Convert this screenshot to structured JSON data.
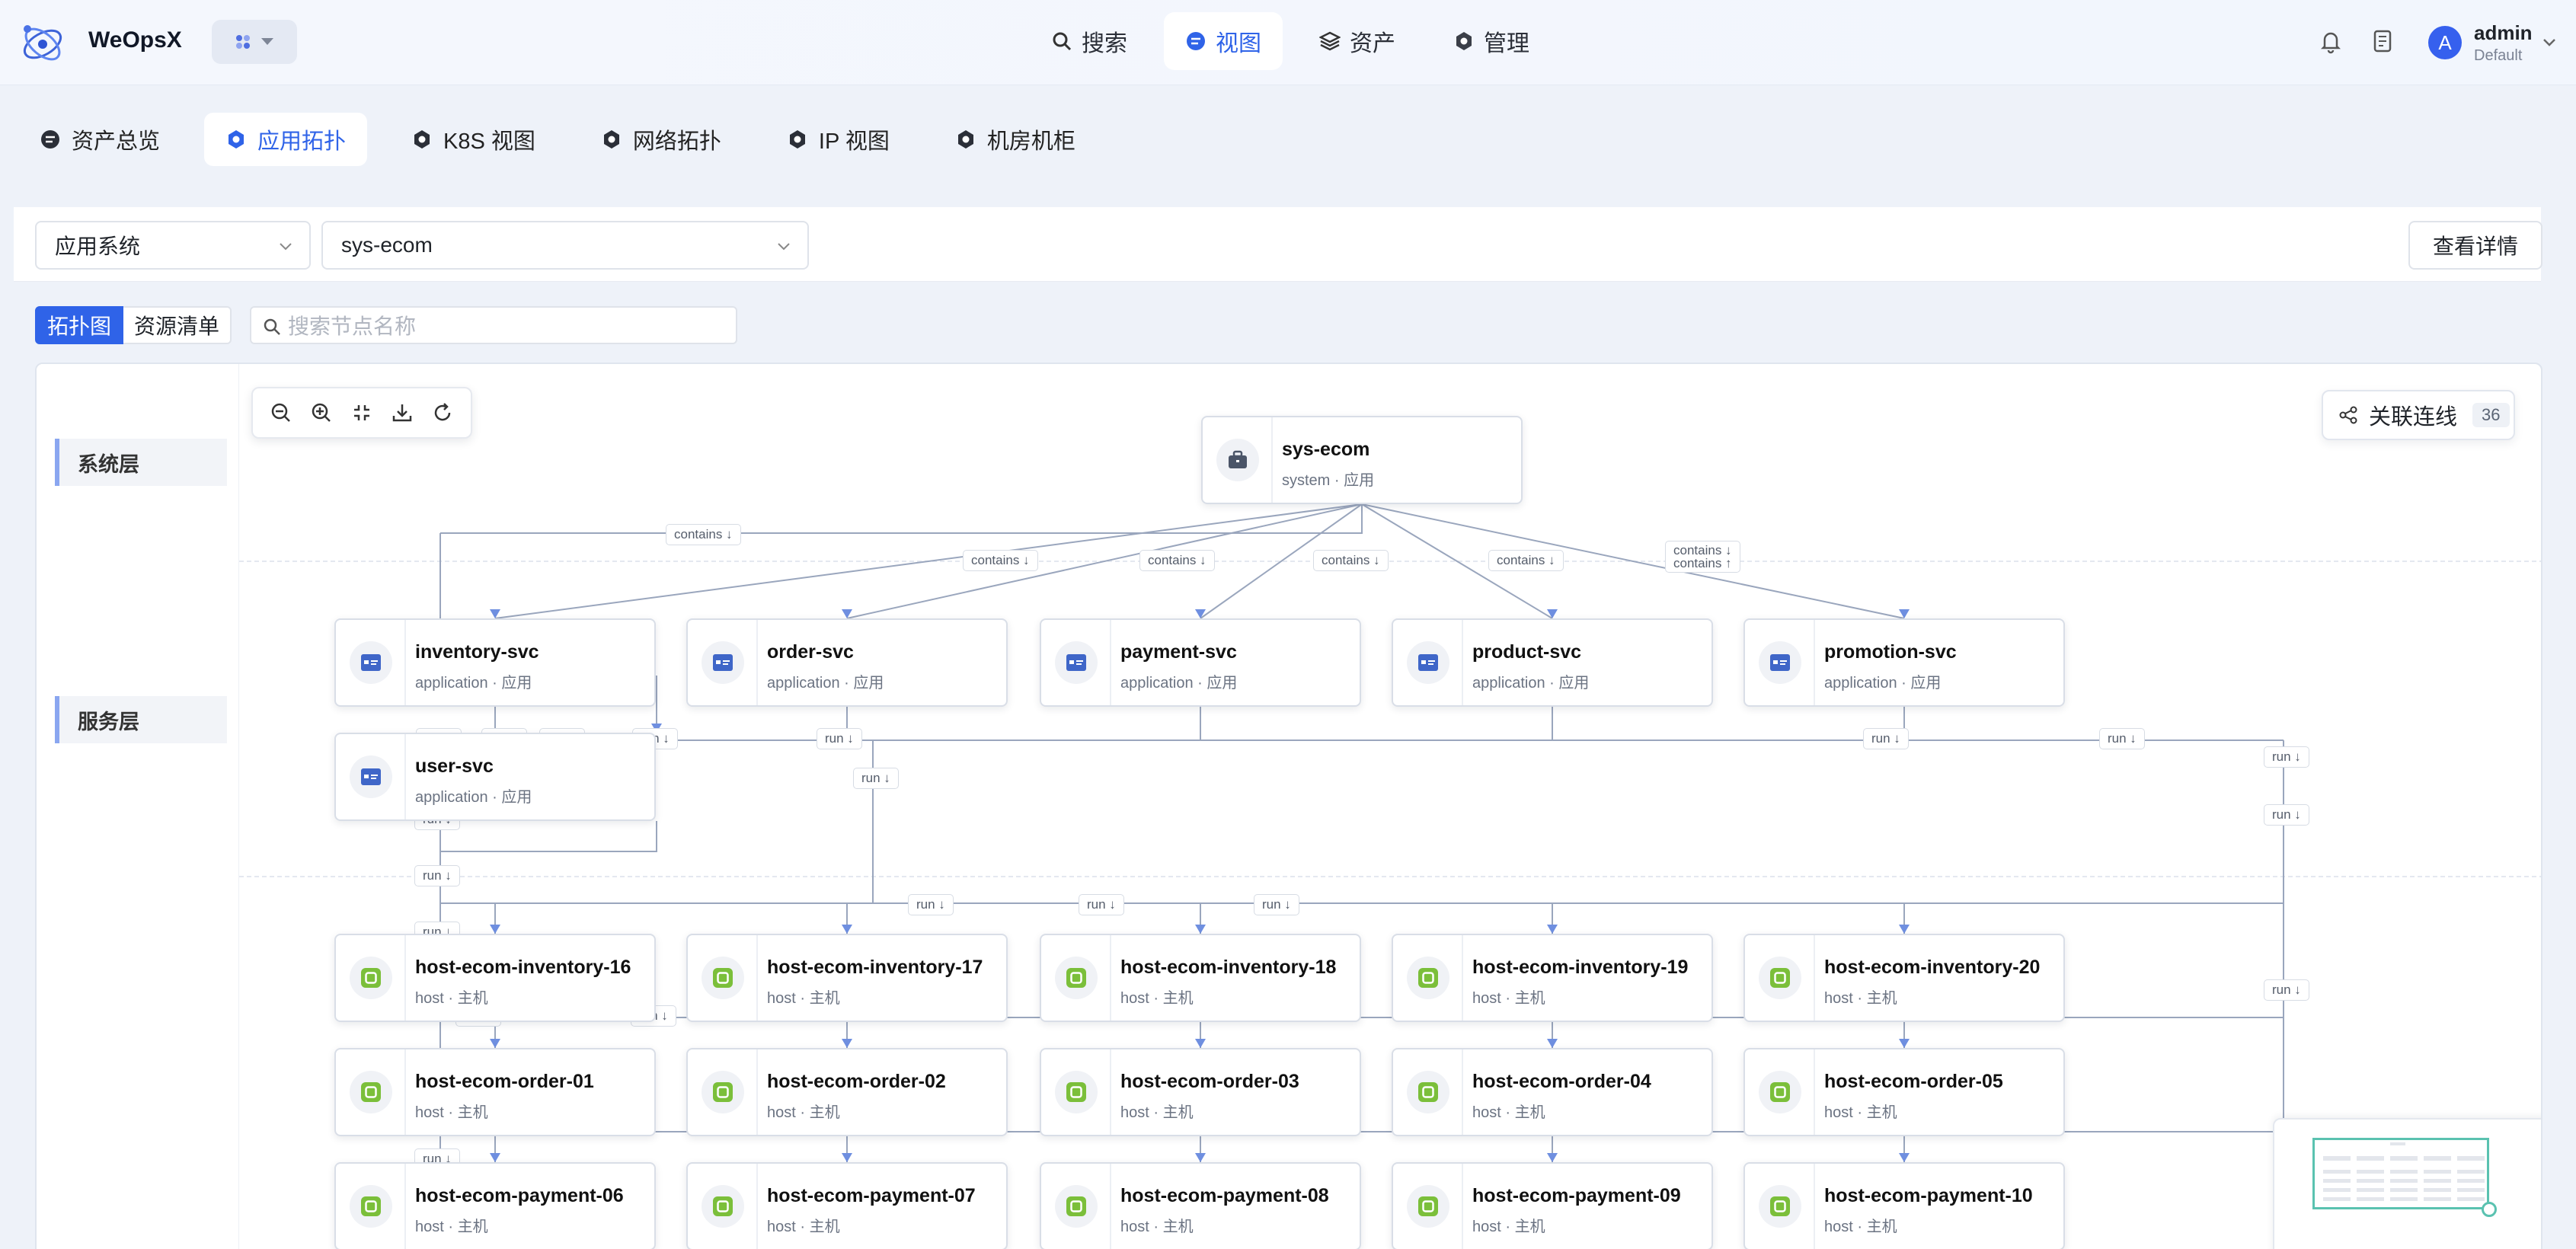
{
  "header": {
    "brand": "WeOpsX",
    "nav": [
      {
        "label": "搜索",
        "icon": "search-icon"
      },
      {
        "label": "视图",
        "icon": "view-icon",
        "active": true
      },
      {
        "label": "资产",
        "icon": "layers-icon"
      },
      {
        "label": "管理",
        "icon": "gear-icon"
      }
    ],
    "user": {
      "initial": "A",
      "name": "admin",
      "tenant": "Default"
    }
  },
  "subnav": [
    {
      "label": "资产总览"
    },
    {
      "label": "应用拓扑",
      "active": true
    },
    {
      "label": "K8S 视图"
    },
    {
      "label": "网络拓扑"
    },
    {
      "label": "IP 视图"
    },
    {
      "label": "机房机柜"
    }
  ],
  "filters": {
    "type_select": "应用系统",
    "system_select": "sys-ecom",
    "detail_button": "查看详情"
  },
  "view_toggle": {
    "topology": "拓扑图",
    "resources": "资源清单"
  },
  "search": {
    "placeholder": "搜索节点名称"
  },
  "layers": {
    "system": "系统层",
    "service": "服务层"
  },
  "links_button": {
    "label": "关联连线",
    "count": "36"
  },
  "colors": {
    "accent": "#2f63e8",
    "app_icon": "#3f66c8",
    "host_icon": "#7bbf3a",
    "edge": "#9aa6bd",
    "edge_arrow": "#6f8fe0",
    "minimap": "#5ac2b0"
  },
  "system_node": {
    "name": "sys-ecom",
    "sub": "system · 应用",
    "icon": "briefcase-icon"
  },
  "service_nodes": [
    {
      "name": "inventory-svc",
      "sub": "application · 应用"
    },
    {
      "name": "order-svc",
      "sub": "application · 应用"
    },
    {
      "name": "payment-svc",
      "sub": "application · 应用"
    },
    {
      "name": "product-svc",
      "sub": "application · 应用"
    },
    {
      "name": "promotion-svc",
      "sub": "application · 应用"
    },
    {
      "name": "user-svc",
      "sub": "application · 应用"
    }
  ],
  "host_nodes": [
    {
      "name": "host-ecom-inventory-16",
      "sub": "host · 主机"
    },
    {
      "name": "host-ecom-inventory-17",
      "sub": "host · 主机"
    },
    {
      "name": "host-ecom-inventory-18",
      "sub": "host · 主机"
    },
    {
      "name": "host-ecom-inventory-19",
      "sub": "host · 主机"
    },
    {
      "name": "host-ecom-inventory-20",
      "sub": "host · 主机"
    },
    {
      "name": "host-ecom-order-01",
      "sub": "host · 主机"
    },
    {
      "name": "host-ecom-order-02",
      "sub": "host · 主机"
    },
    {
      "name": "host-ecom-order-03",
      "sub": "host · 主机"
    },
    {
      "name": "host-ecom-order-04",
      "sub": "host · 主机"
    },
    {
      "name": "host-ecom-order-05",
      "sub": "host · 主机"
    },
    {
      "name": "host-ecom-payment-06",
      "sub": "host · 主机"
    },
    {
      "name": "host-ecom-payment-07",
      "sub": "host · 主机"
    },
    {
      "name": "host-ecom-payment-08",
      "sub": "host · 主机"
    },
    {
      "name": "host-ecom-payment-09",
      "sub": "host · 主机"
    },
    {
      "name": "host-ecom-payment-10",
      "sub": "host · 主机"
    }
  ],
  "edge_labels": {
    "contains": "contains ↓",
    "contains_up": "contains ↑",
    "run": "run ↓"
  }
}
